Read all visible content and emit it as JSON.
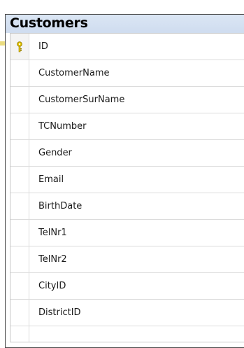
{
  "table": {
    "title": "Customers",
    "columns": [
      {
        "name": "ID",
        "primary_key": true,
        "icon": "key-icon"
      },
      {
        "name": "CustomerName"
      },
      {
        "name": "CustomerSurName"
      },
      {
        "name": "TCNumber"
      },
      {
        "name": "Gender"
      },
      {
        "name": "Email"
      },
      {
        "name": "BirthDate"
      },
      {
        "name": "TelNr1"
      },
      {
        "name": "TelNr2"
      },
      {
        "name": "CityID"
      },
      {
        "name": "DistrictID"
      }
    ]
  },
  "colors": {
    "title_bar": "#d5e1f2",
    "border": "#4a4a4a",
    "grid_line": "#dcdcdc",
    "key": "#e5c700",
    "connector": "#d6b800"
  }
}
